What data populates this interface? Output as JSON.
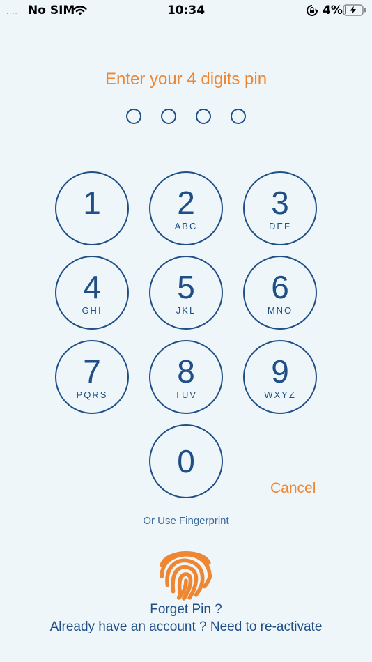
{
  "status_bar": {
    "signal": "....",
    "carrier": "No SIM",
    "time": "10:34",
    "battery_percent": "4%"
  },
  "title": "Enter your 4 digits pin",
  "pin": {
    "length": 4,
    "entered": 0
  },
  "keypad": {
    "keys": [
      {
        "digit": "1",
        "letters": ""
      },
      {
        "digit": "2",
        "letters": "ABC"
      },
      {
        "digit": "3",
        "letters": "DEF"
      },
      {
        "digit": "4",
        "letters": "GHI"
      },
      {
        "digit": "5",
        "letters": "JKL"
      },
      {
        "digit": "6",
        "letters": "MNO"
      },
      {
        "digit": "7",
        "letters": "PQRS"
      },
      {
        "digit": "8",
        "letters": "TUV"
      },
      {
        "digit": "9",
        "letters": "WXYZ"
      },
      {
        "digit": "0",
        "letters": ""
      }
    ]
  },
  "cancel_label": "Cancel",
  "fingerprint_label": "Or Use Fingerprint",
  "forget_pin_label": "Forget Pin ?",
  "reactivate_label": "Already have an account ? Need to re-activate",
  "colors": {
    "accent": "#ef8632",
    "primary": "#1f4f86",
    "background": "#eef6f9"
  },
  "icons": {
    "wifi": "wifi-icon",
    "rotation_lock": "rotation-lock-icon",
    "battery": "battery-charging-icon",
    "fingerprint": "fingerprint-icon"
  }
}
